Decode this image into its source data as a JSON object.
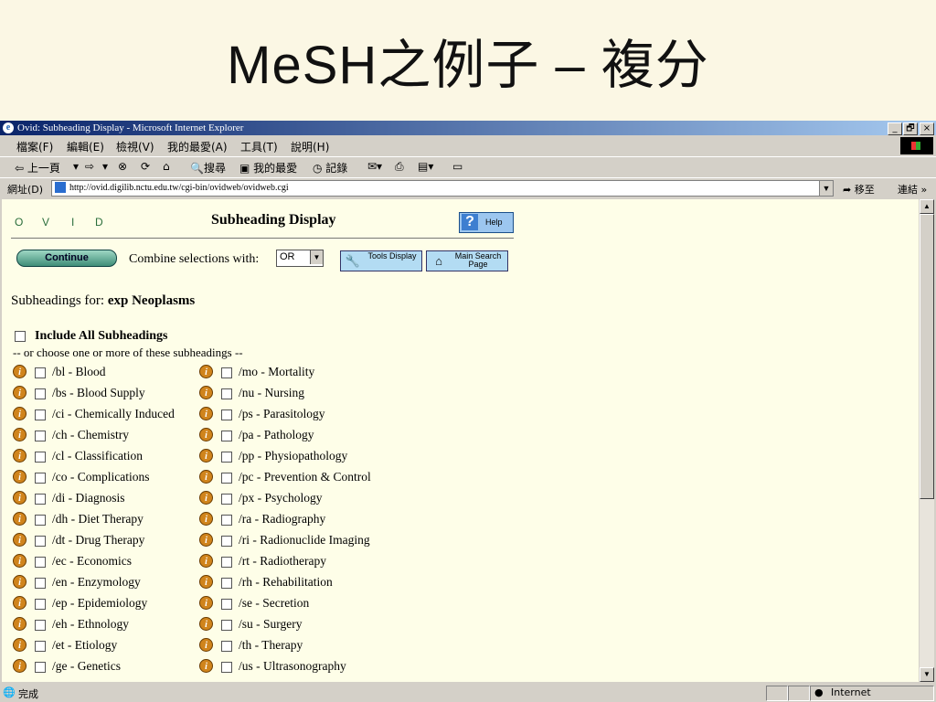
{
  "slide": {
    "title": "MeSH之例子 – 複分"
  },
  "window": {
    "title": "Ovid: Subheading Display - Microsoft Internet Explorer",
    "controls": [
      "_",
      "🗗",
      "×"
    ]
  },
  "menubar": {
    "items": [
      "檔案(F)",
      "編輯(E)",
      "檢視(V)",
      "我的最愛(A)",
      "工具(T)",
      "說明(H)"
    ]
  },
  "toolbar": {
    "back": "⇦ 上一頁",
    "forward": "⇨",
    "stop": "⊗",
    "refresh": "⟳",
    "home": "⌂",
    "search": "搜尋",
    "favorites": "我的最愛",
    "history": "記錄"
  },
  "address": {
    "label": "網址(D)",
    "url": "http://ovid.digilib.nctu.edu.tw/cgi-bin/ovidweb/ovidweb.cgi",
    "go": "移至",
    "links": "連結 »"
  },
  "page": {
    "ovid_letters": [
      "O",
      "V",
      "I",
      "D"
    ],
    "heading": "Subheading Display",
    "help": "Help",
    "continue": "Continue",
    "combine_label": "Combine selections with:",
    "combine_value": "OR",
    "tools_label": "Tools Display",
    "main_label": "Main Search Page",
    "subheadings_for": "Subheadings for:",
    "subject": "exp Neoplasms",
    "include_all": "Include All Subheadings",
    "or_choose": "-- or choose one or more of these subheadings --"
  },
  "subheadings_left": [
    "/bl - Blood",
    "/bs - Blood Supply",
    "/ci - Chemically Induced",
    "/ch - Chemistry",
    "/cl - Classification",
    "/co - Complications",
    "/di - Diagnosis",
    "/dh - Diet Therapy",
    "/dt - Drug Therapy",
    "/ec - Economics",
    "/en - Enzymology",
    "/ep - Epidemiology",
    "/eh - Ethnology",
    "/et - Etiology",
    "/ge - Genetics"
  ],
  "subheadings_right": [
    "/mo - Mortality",
    "/nu - Nursing",
    "/ps - Parasitology",
    "/pa - Pathology",
    "/pp - Physiopathology",
    "/pc - Prevention & Control",
    "/px - Psychology",
    "/ra - Radiography",
    "/ri - Radionuclide Imaging",
    "/rt - Radiotherapy",
    "/rh - Rehabilitation",
    "/se - Secretion",
    "/su - Surgery",
    "/th - Therapy",
    "/us - Ultrasonography"
  ],
  "status": {
    "left": "完成",
    "zone": "Internet"
  }
}
